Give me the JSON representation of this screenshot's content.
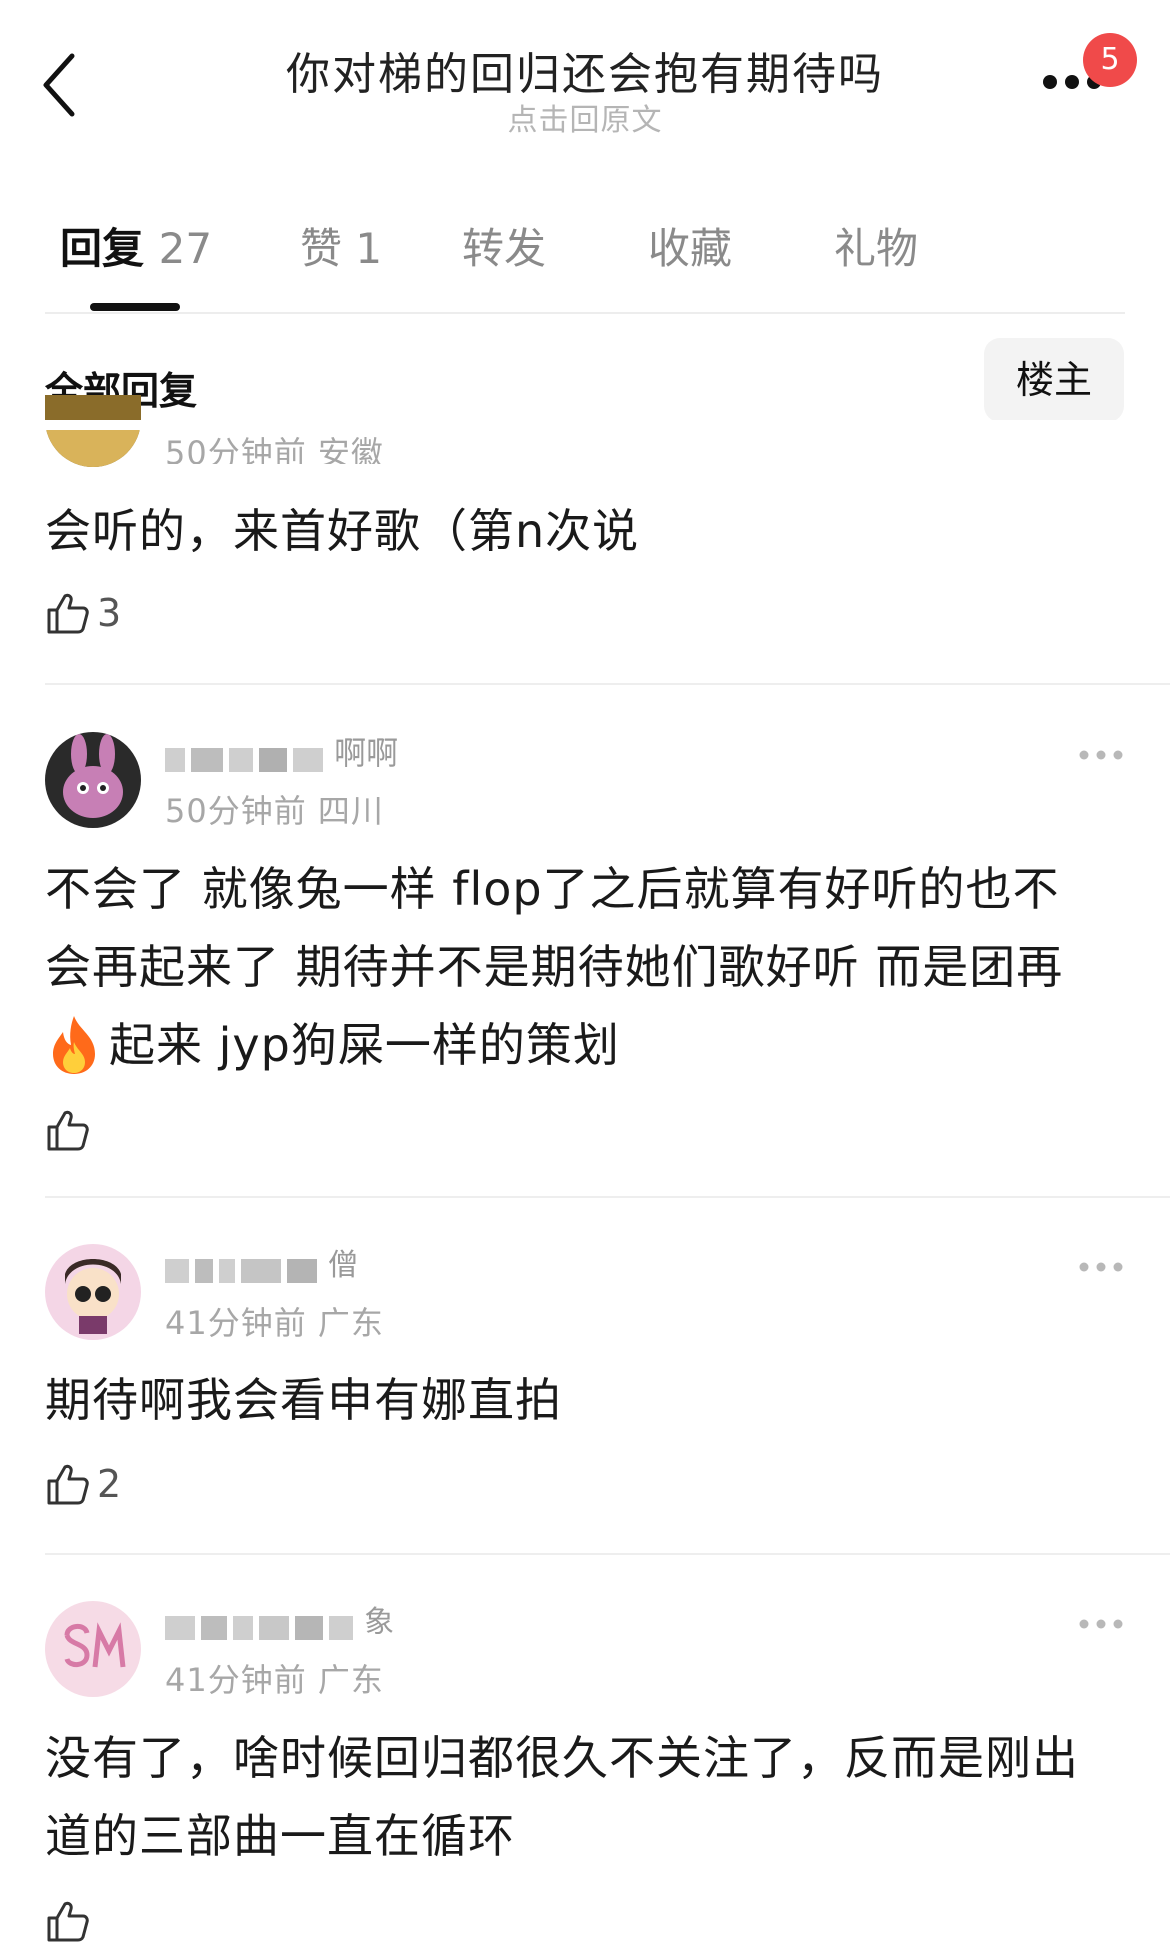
{
  "header": {
    "title": "你对梯的回归还会抱有期待吗",
    "subtitle": "点击回原文",
    "badge_count": "5"
  },
  "tabs": [
    {
      "label": "回复",
      "count": "27",
      "active": true
    },
    {
      "label": "赞",
      "count": "1",
      "active": false
    },
    {
      "label": "转发",
      "count": "",
      "active": false
    },
    {
      "label": "收藏",
      "count": "",
      "active": false
    },
    {
      "label": "礼物",
      "count": "",
      "active": false
    }
  ],
  "filter": {
    "label": "全部回复",
    "owner_button": "楼主"
  },
  "comments": [
    {
      "meta": "50分钟前 安徽",
      "text": "会听的，来首好歌（第n次说",
      "likes": "3"
    },
    {
      "username_visible": "啊啊",
      "meta": "50分钟前 四川",
      "text_lines": [
        "不会了 就像兔一样 flop了之后就算有好听的也不",
        "会再起来了 期待并不是期待她们歌好听 而是团再",
        "起来 jyp狗屎一样的策划"
      ],
      "emoji_icon": "fire-icon",
      "likes": ""
    },
    {
      "username_visible": "僧",
      "meta": "41分钟前 广东",
      "text": "期待啊我会看申有娜直拍",
      "likes": "2"
    },
    {
      "username_visible": "象",
      "meta": "41分钟前 广东",
      "text_lines": [
        "没有了，啥时候回归都很久不关注了，反而是刚出",
        "道的三部曲一直在循环"
      ],
      "likes": ""
    }
  ],
  "colors": {
    "badge": "#f04a4a",
    "meta_text": "#a7a7a7",
    "active_tab": "#111111",
    "inactive_tab": "#8a8a8a"
  }
}
